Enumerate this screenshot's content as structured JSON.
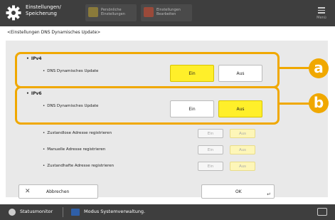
{
  "app": {
    "title_line1": "Einstellungen/",
    "title_line2": "Speicherung",
    "tb_button1_line1": "Persönliche",
    "tb_button1_line2": "Einstellungen",
    "tb_button2_line1": "Einstellungen",
    "tb_button2_line2": "Bearbeiten",
    "menu_label": "Menü"
  },
  "breadcrumb": "<Einstellungen DNS Dynamisches Update>",
  "ipv4": {
    "title": "IPv4",
    "row_label": "DNS Dynamisches Update",
    "on_label": "Ein",
    "off_label": "Aus",
    "selected": "on"
  },
  "ipv6": {
    "title": "IPv6",
    "row_label": "DNS Dynamisches Update",
    "on_label": "Ein",
    "off_label": "Aus",
    "selected": "off"
  },
  "ipv6_sub": [
    {
      "label": "Zustandlose Adresse registrieren",
      "on": "Ein",
      "off": "Aus"
    },
    {
      "label": "Manuelle Adresse registrieren",
      "on": "Ein",
      "off": "Aus"
    },
    {
      "label": "Zustandhafte Adresse registrieren",
      "on": "Ein",
      "off": "Aus"
    }
  ],
  "callouts": {
    "a": "a",
    "b": "b"
  },
  "footer": {
    "cancel": "Abbrechen",
    "ok": "OK"
  },
  "statusbar": {
    "monitor": "Statusmonitor",
    "mode": "Modus Systemverwaltung."
  },
  "colors": {
    "accent": "#f0a800",
    "selected": "#ffef2a",
    "dark": "#3e3e3e"
  }
}
